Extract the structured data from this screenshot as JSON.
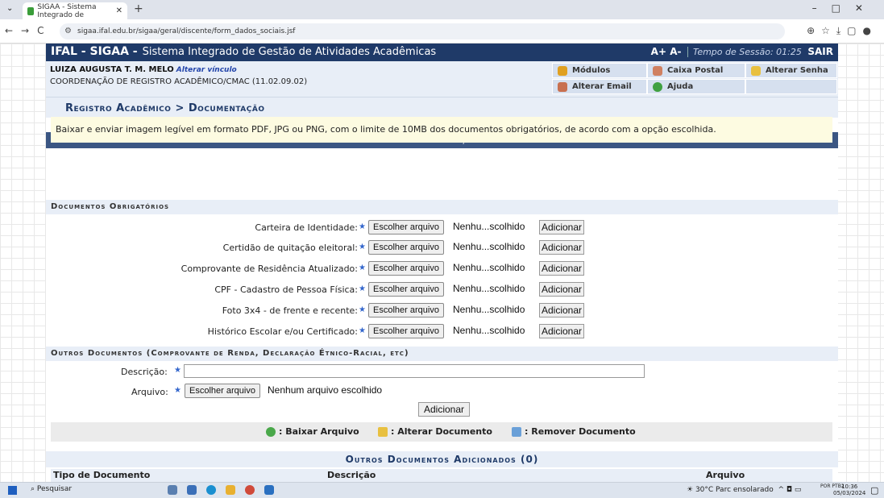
{
  "browser": {
    "tab_title": "SIGAA - Sistema Integrado de",
    "url": "sigaa.ifal.edu.br/sigaa/geral/discente/form_dados_sociais.jsf"
  },
  "header": {
    "title": "IFAL - SIGAA -",
    "subtitle": "Sistema Integrado de Gestão de Atividades Acadêmicas",
    "font_controls": "A+ A-",
    "session_label": "Tempo de Sessão: 01:25",
    "logout": "SAIR"
  },
  "user": {
    "name": "LUIZA AUGUSTA T. M. MELO",
    "alter_link": "Alterar vínculo",
    "department": "COORDENAÇÃO DE REGISTRO ACADÊMICO/CMAC (11.02.09.02)"
  },
  "menu": {
    "modulos": "Módulos",
    "caixa_postal": "Caixa Postal",
    "alterar_senha": "Alterar Senha",
    "alterar_email": "Alterar Email",
    "ajuda": "Ajuda"
  },
  "breadcrumb": "Registro Acadêmico > Documentação",
  "section_title": "Documentação",
  "notice": "Baixar e enviar imagem legível em formato PDF, JPG ou PNG, com o limite de 10MB dos documentos obrigatórios, de acordo com a opção escolhida.",
  "required_section": "Documentos Obrigatórios",
  "required_docs": [
    {
      "label": "Carteira de Identidade:"
    },
    {
      "label": "Certidão de quitação eleitoral:"
    },
    {
      "label": "Comprovante de Residência Atualizado:"
    },
    {
      "label": "CPF - Cadastro de Pessoa Física:"
    },
    {
      "label": "Foto 3x4 - de frente e recente:"
    },
    {
      "label": "Histórico Escolar e/ou Certificado:"
    }
  ],
  "file_button": "Escolher arquivo",
  "file_none_short": "Nenhu...scolhido",
  "add_button": "Adicionar",
  "other_section": "Outros Documentos (Comprovante de Renda, Declaração Étnico-Racial, etc)",
  "other": {
    "descricao_label": "Descrição:",
    "arquivo_label": "Arquivo:",
    "file_none": "Nenhum arquivo escolhido",
    "add_button": "Adicionar"
  },
  "legend": {
    "baixar": ": Baixar Arquivo",
    "alterar": ": Alterar Documento",
    "remover": ": Remover Documento"
  },
  "added_section": "Outros Documentos Adicionados (0)",
  "table_columns": [
    "Tipo de Documento",
    "Descrição",
    "Arquivo"
  ],
  "taskbar": {
    "search": "Pesquisar",
    "weather": "30°C Parc ensolarado",
    "lang": "POR PTB2",
    "time": "10:36",
    "date": "05/03/2024"
  },
  "colors": {
    "header_bg": "#1f3a68",
    "section_bg": "#3b5683",
    "light_bg": "#e8eef7",
    "notice_bg": "#fdfbe1"
  }
}
